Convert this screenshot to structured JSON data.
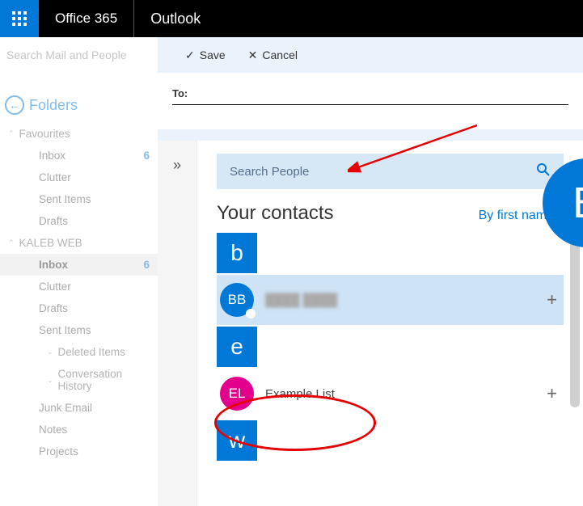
{
  "header": {
    "brand": "Office 365",
    "app": "Outlook"
  },
  "search": {
    "placeholder": "Search Mail and People"
  },
  "folders": {
    "title": "Folders",
    "groups": [
      {
        "label": "Favourites",
        "items": [
          {
            "label": "Inbox",
            "count": "6"
          },
          {
            "label": "Clutter"
          },
          {
            "label": "Sent Items"
          },
          {
            "label": "Drafts"
          }
        ]
      },
      {
        "label": "KALEB WEB",
        "items": [
          {
            "label": "Inbox",
            "count": "6",
            "selected": true
          },
          {
            "label": "Clutter"
          },
          {
            "label": "Drafts"
          },
          {
            "label": "Sent Items"
          },
          {
            "label": "Deleted Items",
            "expandable": true
          },
          {
            "label": "Conversation History",
            "expandable": true
          },
          {
            "label": "Junk Email"
          },
          {
            "label": "Notes"
          },
          {
            "label": "Projects"
          }
        ]
      }
    ]
  },
  "compose": {
    "actions": {
      "save": "Save",
      "cancel": "Cancel"
    },
    "to_label": "To:"
  },
  "people": {
    "expand_glyph": "»",
    "search_placeholder": "Search People",
    "title": "Your contacts",
    "sort": "By first name",
    "letters": {
      "b": "b",
      "e": "e",
      "w": "w"
    },
    "rows": [
      {
        "initials": "BB",
        "name": "████ ████",
        "color": "blue",
        "selected": true,
        "blurred": true
      },
      {
        "initials": "EL",
        "name": "Example List",
        "color": "pink"
      }
    ],
    "side_initial": "B"
  }
}
